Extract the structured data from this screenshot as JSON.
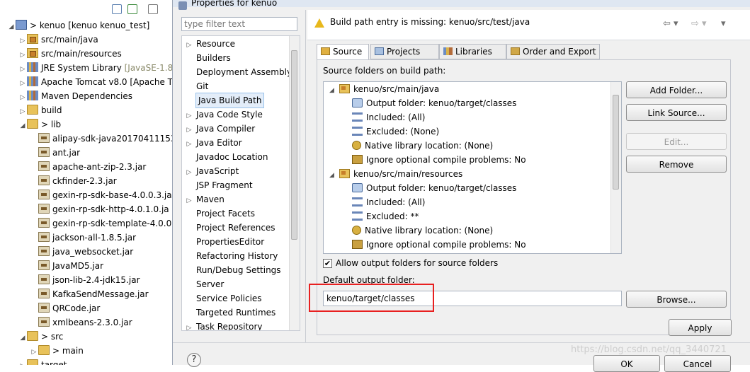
{
  "explorer": {
    "items": [
      {
        "label": "> kenuo [kenuo kenuo_test]",
        "icon": "project-icon",
        "arrow": "◢",
        "indent": 0,
        "extra": ""
      },
      {
        "label": "src/main/java",
        "icon": "package-folder-icon",
        "arrow": "▷",
        "indent": 1,
        "extra": ""
      },
      {
        "label": "src/main/resources",
        "icon": "package-folder-icon",
        "arrow": "▷",
        "indent": 1,
        "extra": ""
      },
      {
        "label": "JRE System Library ",
        "icon": "library-icon",
        "arrow": "▷",
        "indent": 1,
        "extra": "[JavaSE-1.8"
      },
      {
        "label": "Apache Tomcat v8.0 [Apache T",
        "icon": "library-icon",
        "arrow": "▷",
        "indent": 1,
        "extra": ""
      },
      {
        "label": "Maven Dependencies",
        "icon": "library-icon",
        "arrow": "▷",
        "indent": 1,
        "extra": ""
      },
      {
        "label": "build",
        "icon": "folder-icon",
        "arrow": "▷",
        "indent": 1,
        "extra": ""
      },
      {
        "label": "> lib",
        "icon": "folder-icon",
        "arrow": "◢",
        "indent": 1,
        "extra": ""
      },
      {
        "label": "alipay-sdk-java20170411153",
        "icon": "jar-icon",
        "arrow": "",
        "indent": 2,
        "extra": ""
      },
      {
        "label": "ant.jar",
        "icon": "jar-icon",
        "arrow": "",
        "indent": 2,
        "extra": ""
      },
      {
        "label": "apache-ant-zip-2.3.jar",
        "icon": "jar-icon",
        "arrow": "",
        "indent": 2,
        "extra": ""
      },
      {
        "label": "ckfinder-2.3.jar",
        "icon": "jar-icon",
        "arrow": "",
        "indent": 2,
        "extra": ""
      },
      {
        "label": "gexin-rp-sdk-base-4.0.0.3.ja",
        "icon": "jar-icon",
        "arrow": "",
        "indent": 2,
        "extra": ""
      },
      {
        "label": "gexin-rp-sdk-http-4.0.1.0.ja",
        "icon": "jar-icon",
        "arrow": "",
        "indent": 2,
        "extra": ""
      },
      {
        "label": "gexin-rp-sdk-template-4.0.0",
        "icon": "jar-icon",
        "arrow": "",
        "indent": 2,
        "extra": ""
      },
      {
        "label": "jackson-all-1.8.5.jar",
        "icon": "jar-icon",
        "arrow": "",
        "indent": 2,
        "extra": ""
      },
      {
        "label": "java_websocket.jar",
        "icon": "jar-icon",
        "arrow": "",
        "indent": 2,
        "extra": ""
      },
      {
        "label": "JavaMD5.jar",
        "icon": "jar-icon",
        "arrow": "",
        "indent": 2,
        "extra": ""
      },
      {
        "label": "json-lib-2.4-jdk15.jar",
        "icon": "jar-icon",
        "arrow": "",
        "indent": 2,
        "extra": ""
      },
      {
        "label": "KafkaSendMessage.jar",
        "icon": "jar-icon",
        "arrow": "",
        "indent": 2,
        "extra": ""
      },
      {
        "label": "QRCode.jar",
        "icon": "jar-icon",
        "arrow": "",
        "indent": 2,
        "extra": ""
      },
      {
        "label": "xmlbeans-2.3.0.jar",
        "icon": "jar-icon",
        "arrow": "",
        "indent": 2,
        "extra": ""
      },
      {
        "label": "> src",
        "icon": "folder-icon",
        "arrow": "◢",
        "indent": 1,
        "extra": ""
      },
      {
        "label": "> main",
        "icon": "folder-icon",
        "arrow": "▷",
        "indent": 2,
        "extra": ""
      },
      {
        "label": "target",
        "icon": "folder-icon",
        "arrow": "▷",
        "indent": 1,
        "extra": ""
      }
    ]
  },
  "dialog": {
    "title": "Properties for kenuo",
    "filter_placeholder": "type filter text",
    "nav": [
      {
        "label": "Resource",
        "arrow": "▷",
        "selected": false
      },
      {
        "label": "Builders",
        "arrow": "",
        "selected": false
      },
      {
        "label": "Deployment Assembly",
        "arrow": "",
        "selected": false
      },
      {
        "label": "Git",
        "arrow": "",
        "selected": false
      },
      {
        "label": "Java Build Path",
        "arrow": "",
        "selected": true
      },
      {
        "label": "Java Code Style",
        "arrow": "▷",
        "selected": false
      },
      {
        "label": "Java Compiler",
        "arrow": "▷",
        "selected": false
      },
      {
        "label": "Java Editor",
        "arrow": "▷",
        "selected": false
      },
      {
        "label": "Javadoc Location",
        "arrow": "",
        "selected": false
      },
      {
        "label": "JavaScript",
        "arrow": "▷",
        "selected": false
      },
      {
        "label": "JSP Fragment",
        "arrow": "",
        "selected": false
      },
      {
        "label": "Maven",
        "arrow": "▷",
        "selected": false
      },
      {
        "label": "Project Facets",
        "arrow": "",
        "selected": false
      },
      {
        "label": "Project References",
        "arrow": "",
        "selected": false
      },
      {
        "label": "PropertiesEditor",
        "arrow": "",
        "selected": false
      },
      {
        "label": "Refactoring History",
        "arrow": "",
        "selected": false
      },
      {
        "label": "Run/Debug Settings",
        "arrow": "",
        "selected": false
      },
      {
        "label": "Server",
        "arrow": "",
        "selected": false
      },
      {
        "label": "Service Policies",
        "arrow": "",
        "selected": false
      },
      {
        "label": "Targeted Runtimes",
        "arrow": "",
        "selected": false
      },
      {
        "label": "Task Repository",
        "arrow": "▷",
        "selected": false
      }
    ],
    "warning": "Build path entry is missing: kenuo/src/test/java",
    "tabs": [
      "Source",
      "Projects",
      "Libraries",
      "Order and Export"
    ],
    "source_label": "Source folders on build path:",
    "source_tree": [
      {
        "label": "kenuo/src/main/java",
        "icon": "source-folder-icon",
        "level": 0
      },
      {
        "label": "Output folder: kenuo/target/classes",
        "icon": "output-folder-icon",
        "level": 1
      },
      {
        "label": "Included: (All)",
        "icon": "included-filter-icon",
        "level": 1
      },
      {
        "label": "Excluded: (None)",
        "icon": "excluded-filter-icon",
        "level": 1
      },
      {
        "label": "Native library location: (None)",
        "icon": "native-library-icon",
        "level": 1
      },
      {
        "label": "Ignore optional compile problems: No",
        "icon": "ignore-problems-icon",
        "level": 1
      },
      {
        "label": "kenuo/src/main/resources",
        "icon": "source-folder-icon",
        "level": 0
      },
      {
        "label": "Output folder: kenuo/target/classes",
        "icon": "output-folder-icon",
        "level": 1
      },
      {
        "label": "Included: (All)",
        "icon": "included-filter-icon",
        "level": 1
      },
      {
        "label": "Excluded: **",
        "icon": "excluded-filter-icon",
        "level": 1
      },
      {
        "label": "Native library location: (None)",
        "icon": "native-library-icon",
        "level": 1
      },
      {
        "label": "Ignore optional compile problems: No",
        "icon": "ignore-problems-icon",
        "level": 1
      }
    ],
    "buttons": {
      "add_folder": "Add Folder...",
      "link_source": "Link Source...",
      "edit": "Edit...",
      "remove": "Remove",
      "browse": "Browse...",
      "apply": "Apply",
      "ok": "OK",
      "cancel": "Cancel"
    },
    "allow_output_label": "Allow output folders for source folders",
    "allow_output_checked": "✔",
    "default_output_label": "Default output folder:",
    "default_output_value": "kenuo/target/classes",
    "help_glyph": "?"
  },
  "watermark": "https://blog.csdn.net/qq_3440721",
  "colors": {
    "highlight": "#e82020",
    "selection": "#e3edf9",
    "warning": "#e8b81c"
  }
}
